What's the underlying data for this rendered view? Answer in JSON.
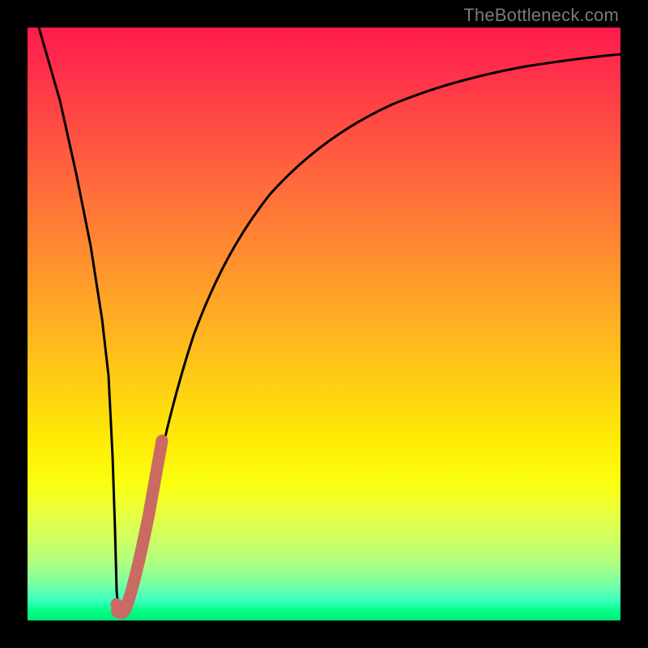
{
  "watermark": "TheBottleneck.com",
  "colors": {
    "curve_main": "#000000",
    "curve_accent": "#c96a63",
    "frame": "#000000"
  },
  "chart_data": {
    "type": "line",
    "title": "",
    "xlabel": "",
    "ylabel": "",
    "xlim": [
      0,
      100
    ],
    "ylim": [
      0,
      100
    ],
    "grid": false,
    "legend": false,
    "series": [
      {
        "name": "bottleneck-curve",
        "x": [
          2,
          4,
          6,
          8,
          10,
          11,
          12,
          13,
          14,
          15,
          16,
          18,
          20,
          22,
          25,
          30,
          35,
          40,
          45,
          50,
          55,
          60,
          65,
          70,
          75,
          80,
          85,
          90,
          95,
          100
        ],
        "y": [
          100,
          88,
          76,
          64,
          52,
          41,
          27,
          12,
          3,
          1,
          2,
          8,
          16,
          24,
          35,
          50,
          61,
          69,
          75,
          80,
          84,
          87,
          89.5,
          91.5,
          93,
          94,
          95,
          95.7,
          96.2,
          96.6
        ]
      },
      {
        "name": "highlight-segment",
        "x": [
          14.2,
          15,
          16,
          17,
          18,
          19,
          20,
          21,
          22
        ],
        "y": [
          2.5,
          1.5,
          3,
          7,
          12,
          18,
          24,
          30,
          36
        ]
      }
    ],
    "annotations": []
  }
}
